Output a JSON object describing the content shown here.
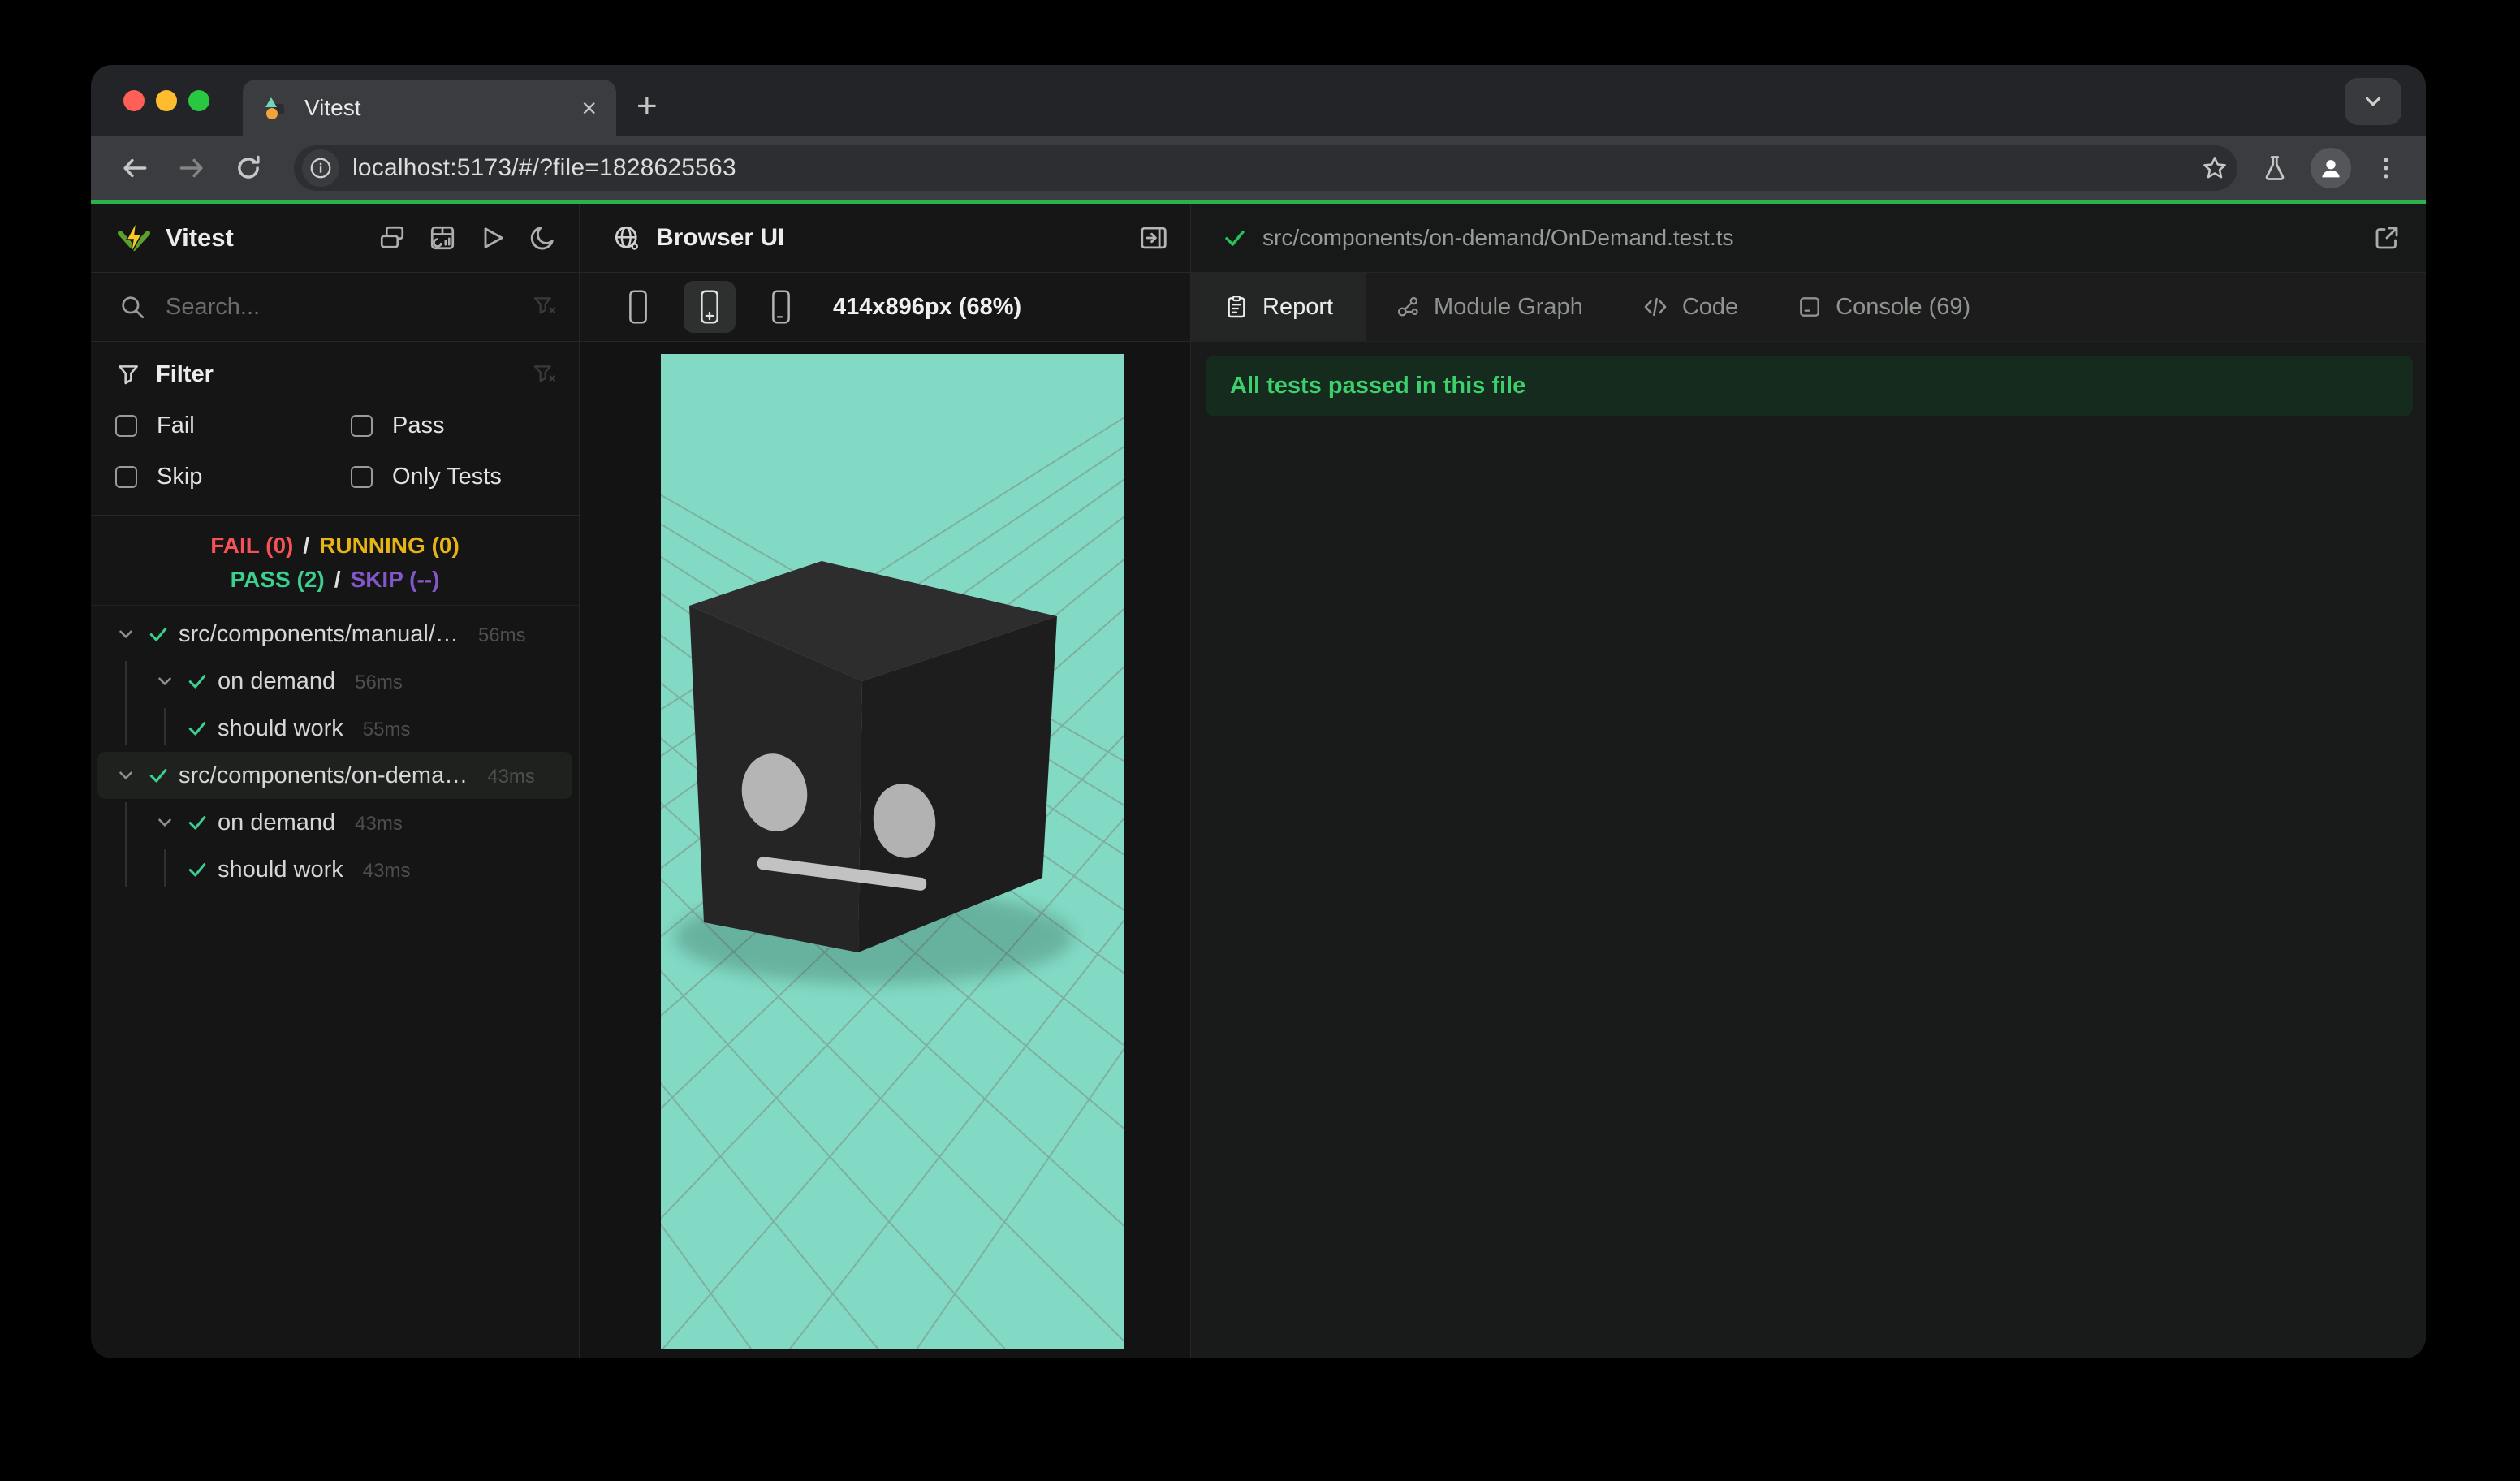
{
  "browser": {
    "tab_title": "Vitest",
    "close_tab_glyph": "×",
    "new_tab_glyph": "+",
    "url": "localhost:5173/#/?file=1828625563"
  },
  "sidebar": {
    "title": "Vitest",
    "search_placeholder": "Search...",
    "filter": {
      "title": "Filter",
      "options": [
        "Fail",
        "Pass",
        "Skip",
        "Only Tests"
      ]
    },
    "summary": {
      "fail": "FAIL (0)",
      "running": "RUNNING (0)",
      "pass": "PASS (2)",
      "skip": "SKIP (--)",
      "separator": "/"
    },
    "tree": [
      {
        "label": "src/components/manual/…",
        "duration": "56ms"
      },
      {
        "label": "on demand",
        "duration": "56ms"
      },
      {
        "label": "should work",
        "duration": "55ms"
      },
      {
        "label": "src/components/on-dema…",
        "duration": "43ms"
      },
      {
        "label": "on demand",
        "duration": "43ms"
      },
      {
        "label": "should work",
        "duration": "43ms"
      }
    ]
  },
  "preview": {
    "title": "Browser UI",
    "size_label": "414x896px (68%)"
  },
  "results": {
    "file_path": "src/components/on-demand/OnDemand.test.ts",
    "tabs": [
      "Report",
      "Module Graph",
      "Code",
      "Console (69)"
    ],
    "banner": "All tests passed in this file"
  },
  "colors": {
    "progress_green": "#2bb24c",
    "viewport_mint": "#82d9c4",
    "pass_green": "#3ccf8e",
    "fail_red": "#f65157",
    "running_yellow": "#e7b416",
    "skip_purple": "#8257c8",
    "banner_bg": "#152b1e",
    "banner_text": "#3dd06c"
  }
}
